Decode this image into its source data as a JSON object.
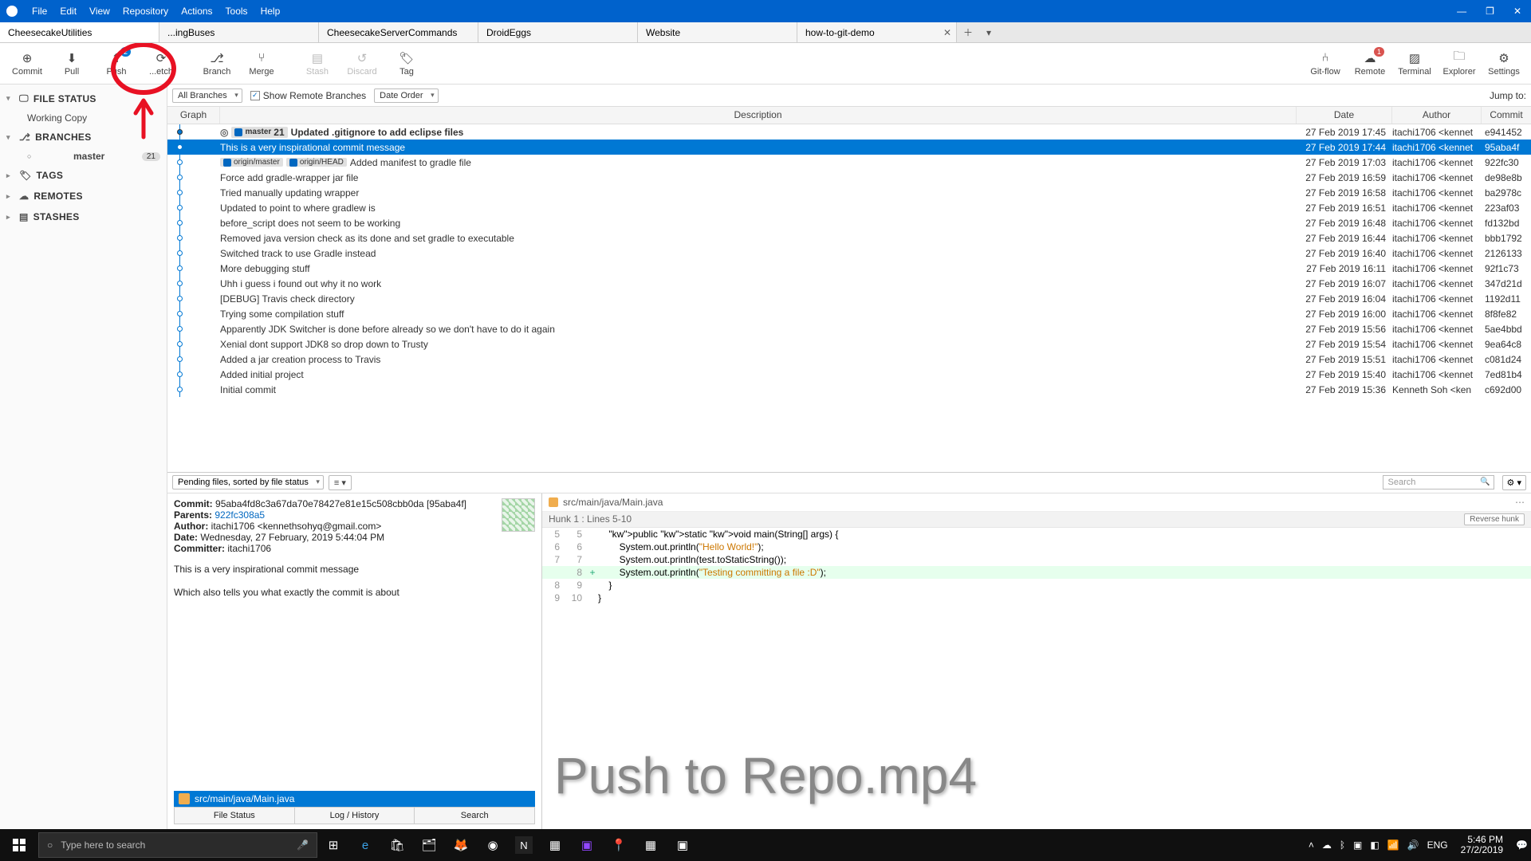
{
  "menu": {
    "items": [
      "File",
      "Edit",
      "View",
      "Repository",
      "Actions",
      "Tools",
      "Help"
    ]
  },
  "tabs": {
    "items": [
      {
        "label": "CheesecakeUtilities",
        "active": true
      },
      {
        "label": "...ingBuses"
      },
      {
        "label": "CheesecakeServerCommands"
      },
      {
        "label": "DroidEggs"
      },
      {
        "label": "Website"
      },
      {
        "label": "how-to-git-demo",
        "closeable": true
      }
    ]
  },
  "toolbar": {
    "commit": "Commit",
    "pull": "Pull",
    "push": "Push",
    "fetch": "...etch",
    "branch": "Branch",
    "merge": "Merge",
    "stash": "Stash",
    "discard": "Discard",
    "tag": "Tag",
    "gitflow": "Git-flow",
    "remote": "Remote",
    "terminal": "Terminal",
    "explorer": "Explorer",
    "settings": "Settings",
    "push_badge": "2",
    "remote_badge": "1"
  },
  "sidebar": {
    "filestatus": "FILE STATUS",
    "working_copy": "Working Copy",
    "branches": "BRANCHES",
    "master": "master",
    "master_count": "21",
    "tags": "TAGS",
    "remotes": "REMOTES",
    "stashes": "STASHES"
  },
  "filter": {
    "all_branches": "All Branches",
    "show_remote": "Show Remote Branches",
    "date_order": "Date Order",
    "jump": "Jump to:"
  },
  "grid": {
    "graph": "Graph",
    "desc": "Description",
    "date": "Date",
    "author": "Author",
    "commit": "Commit"
  },
  "commits": [
    {
      "tags": [
        {
          "t": "master",
          "c": "21"
        }
      ],
      "desc": "Updated .gitignore to add eclipse files",
      "date": "27 Feb 2019 17:45",
      "author": "itachi1706 <kennet",
      "commit": "e941452",
      "first": true
    },
    {
      "desc": "This is a very inspirational commit message",
      "date": "27 Feb 2019 17:44",
      "author": "itachi1706 <kennet",
      "commit": "95aba4f",
      "sel": true
    },
    {
      "tags": [
        {
          "t": "origin/master"
        },
        {
          "t": "origin/HEAD"
        }
      ],
      "desc": "Added manifest to gradle file",
      "date": "27 Feb 2019 17:03",
      "author": "itachi1706 <kennet",
      "commit": "922fc30"
    },
    {
      "desc": "Force add gradle-wrapper jar file",
      "date": "27 Feb 2019 16:59",
      "author": "itachi1706 <kennet",
      "commit": "de98e8b"
    },
    {
      "desc": "Tried manually updating wrapper",
      "date": "27 Feb 2019 16:58",
      "author": "itachi1706 <kennet",
      "commit": "ba2978c"
    },
    {
      "desc": "Updated to point to where gradlew is",
      "date": "27 Feb 2019 16:51",
      "author": "itachi1706 <kennet",
      "commit": "223af03"
    },
    {
      "desc": "before_script does not seem to be working",
      "date": "27 Feb 2019 16:48",
      "author": "itachi1706 <kennet",
      "commit": "fd132bd"
    },
    {
      "desc": "Removed java version check as its done and set gradle to executable",
      "date": "27 Feb 2019 16:44",
      "author": "itachi1706 <kennet",
      "commit": "bbb1792"
    },
    {
      "desc": "Switched track to use Gradle instead",
      "date": "27 Feb 2019 16:40",
      "author": "itachi1706 <kennet",
      "commit": "2126133"
    },
    {
      "desc": "More debugging stuff",
      "date": "27 Feb 2019 16:11",
      "author": "itachi1706 <kennet",
      "commit": "92f1c73"
    },
    {
      "desc": "Uhh i guess i found out why it no work",
      "date": "27 Feb 2019 16:07",
      "author": "itachi1706 <kennet",
      "commit": "347d21d"
    },
    {
      "desc": "[DEBUG] Travis check directory",
      "date": "27 Feb 2019 16:04",
      "author": "itachi1706 <kennet",
      "commit": "1192d11"
    },
    {
      "desc": "Trying some compilation stuff",
      "date": "27 Feb 2019 16:00",
      "author": "itachi1706 <kennet",
      "commit": "8f8fe82"
    },
    {
      "desc": "Apparently JDK Switcher is done before already so we don't have to do it again",
      "date": "27 Feb 2019 15:56",
      "author": "itachi1706 <kennet",
      "commit": "5ae4bbd"
    },
    {
      "desc": "Xenial dont support JDK8 so drop down to Trusty",
      "date": "27 Feb 2019 15:54",
      "author": "itachi1706 <kennet",
      "commit": "9ea64c8"
    },
    {
      "desc": "Added a jar creation process to Travis",
      "date": "27 Feb 2019 15:51",
      "author": "itachi1706 <kennet",
      "commit": "c081d24"
    },
    {
      "desc": "Added initial project",
      "date": "27 Feb 2019 15:40",
      "author": "itachi1706 <kennet",
      "commit": "7ed81b4"
    },
    {
      "desc": "Initial commit",
      "date": "27 Feb 2019 15:36",
      "author": "Kenneth Soh <ken",
      "commit": "c692d00"
    }
  ],
  "detail": {
    "pending": "Pending files, sorted by file status",
    "search_ph": "Search",
    "commit_lbl": "Commit:",
    "commit_val": "95aba4fd8c3a67da70e78427e81e15c508cbb0da [95aba4f]",
    "parents_lbl": "Parents:",
    "parents_val": "922fc308a5",
    "author_lbl": "Author:",
    "author_val": "itachi1706 <kennethsohyq@gmail.com>",
    "date_lbl": "Date:",
    "date_val": "Wednesday, 27 February, 2019 5:44:04 PM",
    "committer_lbl": "Committer:",
    "committer_val": "itachi1706",
    "msg1": "This is a very inspirational commit message",
    "msg2": "Which also tells you what exactly the commit is about",
    "file": "src/main/java/Main.java",
    "tabs": {
      "file_status": "File Status",
      "log": "Log / History",
      "search": "Search"
    }
  },
  "diff": {
    "file": "src/main/java/Main.java",
    "hunk": "Hunk 1 : Lines 5-10",
    "reverse": "Reverse hunk",
    "lines": [
      {
        "a": "5",
        "b": "5",
        "txt": "    public static void main(String[] args) {"
      },
      {
        "a": "6",
        "b": "6",
        "txt": "        System.out.println(\"Hello World!\");"
      },
      {
        "a": "7",
        "b": "7",
        "txt": "        System.out.println(test.toStaticString());"
      },
      {
        "a": "",
        "b": "8",
        "txt": "        System.out.println(\"Testing committing a file :D\");",
        "add": true,
        "marker": "+"
      },
      {
        "a": "8",
        "b": "9",
        "txt": "    }"
      },
      {
        "a": "9",
        "b": "10",
        "txt": "}"
      }
    ]
  },
  "overlay": "Push to Repo.mp4",
  "taskbar": {
    "search_ph": "Type here to search",
    "lang": "ENG",
    "time": "5:46 PM",
    "date": "27/2/2019"
  }
}
